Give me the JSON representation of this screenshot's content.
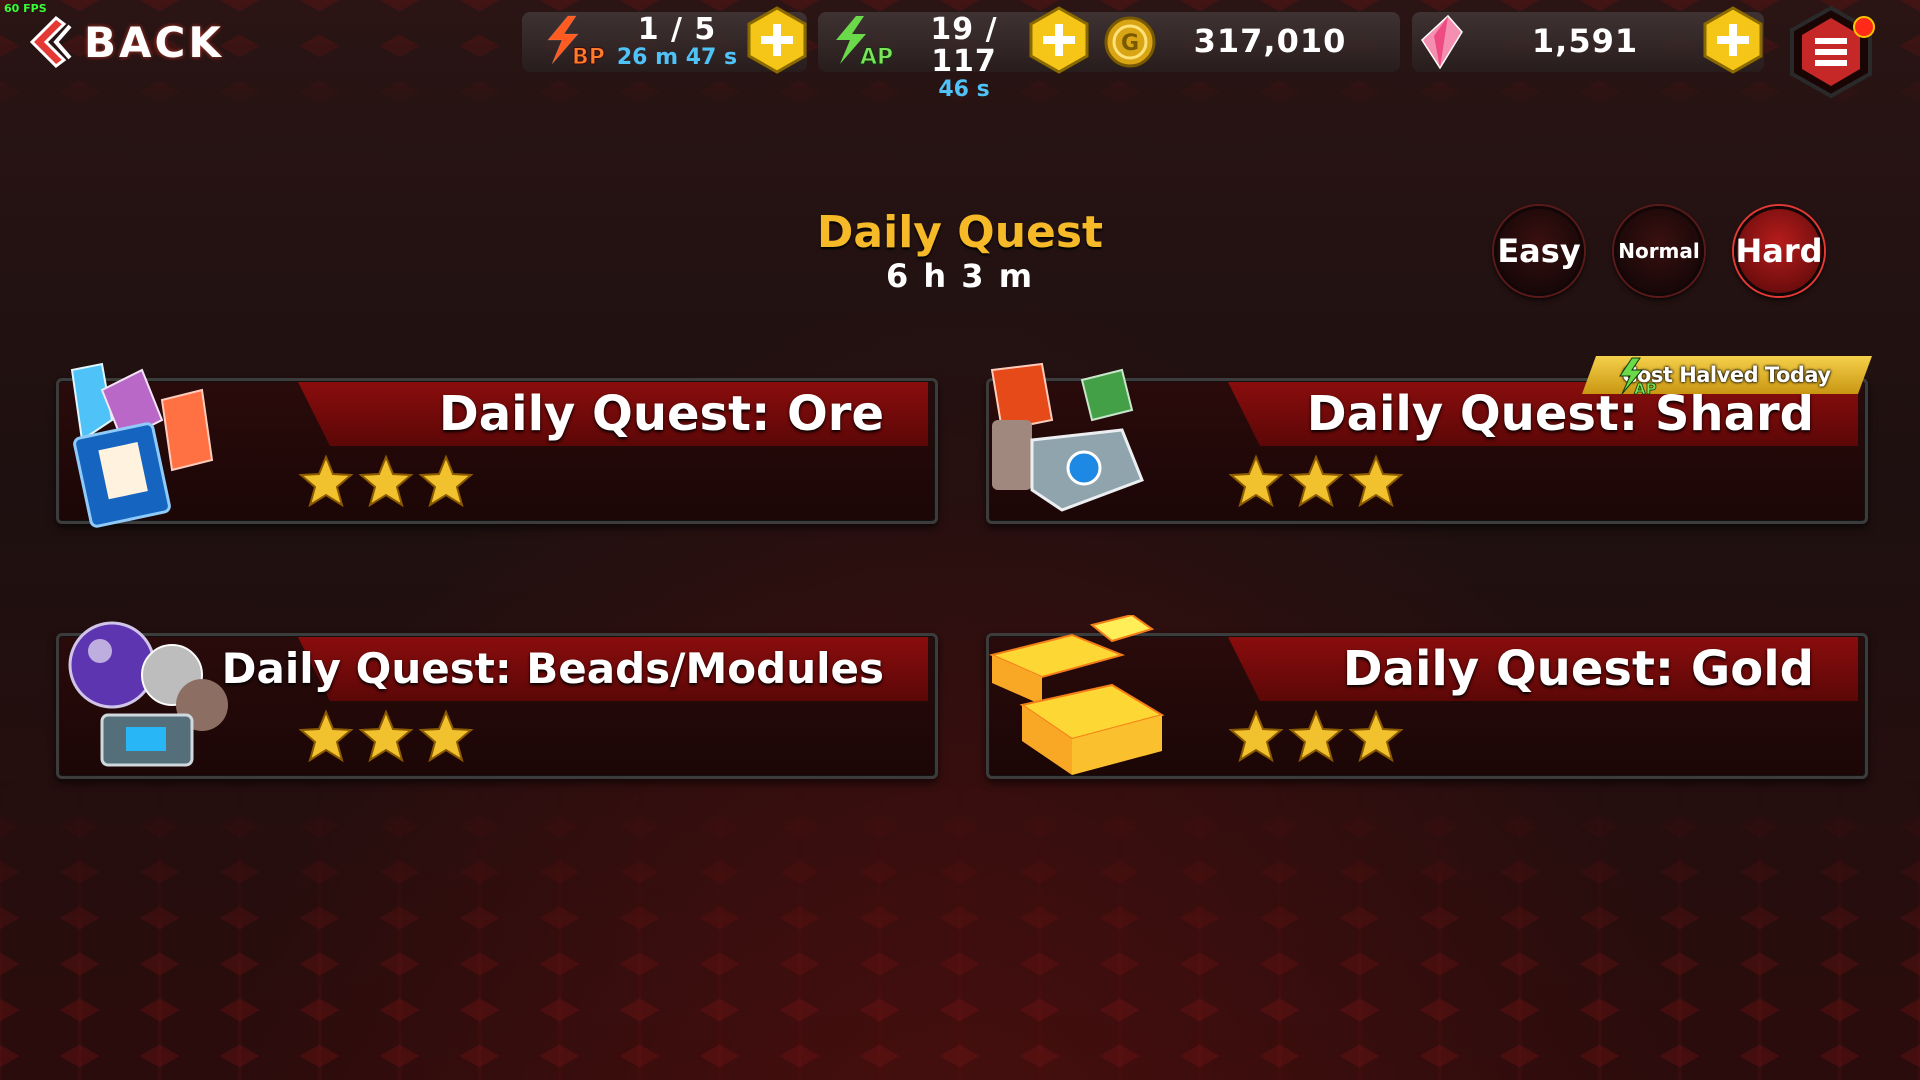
{
  "hud": {
    "fps": "60 FPS",
    "back_label": "BACK",
    "bp": {
      "icon": "bp-lightning-icon",
      "label": "BP",
      "value": "1 / 5",
      "timer": "26 m 47 s"
    },
    "ap": {
      "icon": "ap-lightning-icon",
      "label": "AP",
      "value": "19 / 117",
      "timer": "46 s"
    },
    "gold": {
      "icon": "gold-coin-icon",
      "value": "317,010"
    },
    "gems": {
      "icon": "pink-crystal-icon",
      "value": "1,591"
    }
  },
  "header": {
    "title": "Daily Quest",
    "timer": "6 h 3 m"
  },
  "difficulty": {
    "options": [
      "Easy",
      "Normal",
      "Hard"
    ],
    "selected": "Hard"
  },
  "quests": [
    {
      "name": "Daily Quest: Ore",
      "stars": 3,
      "icon": "ore-crystals-icon"
    },
    {
      "name": "Daily Quest: Shard",
      "stars": 3,
      "icon": "shard-chest-icon",
      "badge": "Cost Halved Today",
      "badge_icon_label": "AP"
    },
    {
      "name": "Daily Quest: Beads/Modules",
      "stars": 3,
      "icon": "beads-modules-icon"
    },
    {
      "name": "Daily Quest: Gold",
      "stars": 3,
      "icon": "gold-bars-icon"
    }
  ],
  "colors": {
    "title_gold": "#f6b928",
    "banner_red": "#8a0d0d",
    "timer_blue": "#4fc3f7",
    "plus_yellow": "#f5c518"
  }
}
